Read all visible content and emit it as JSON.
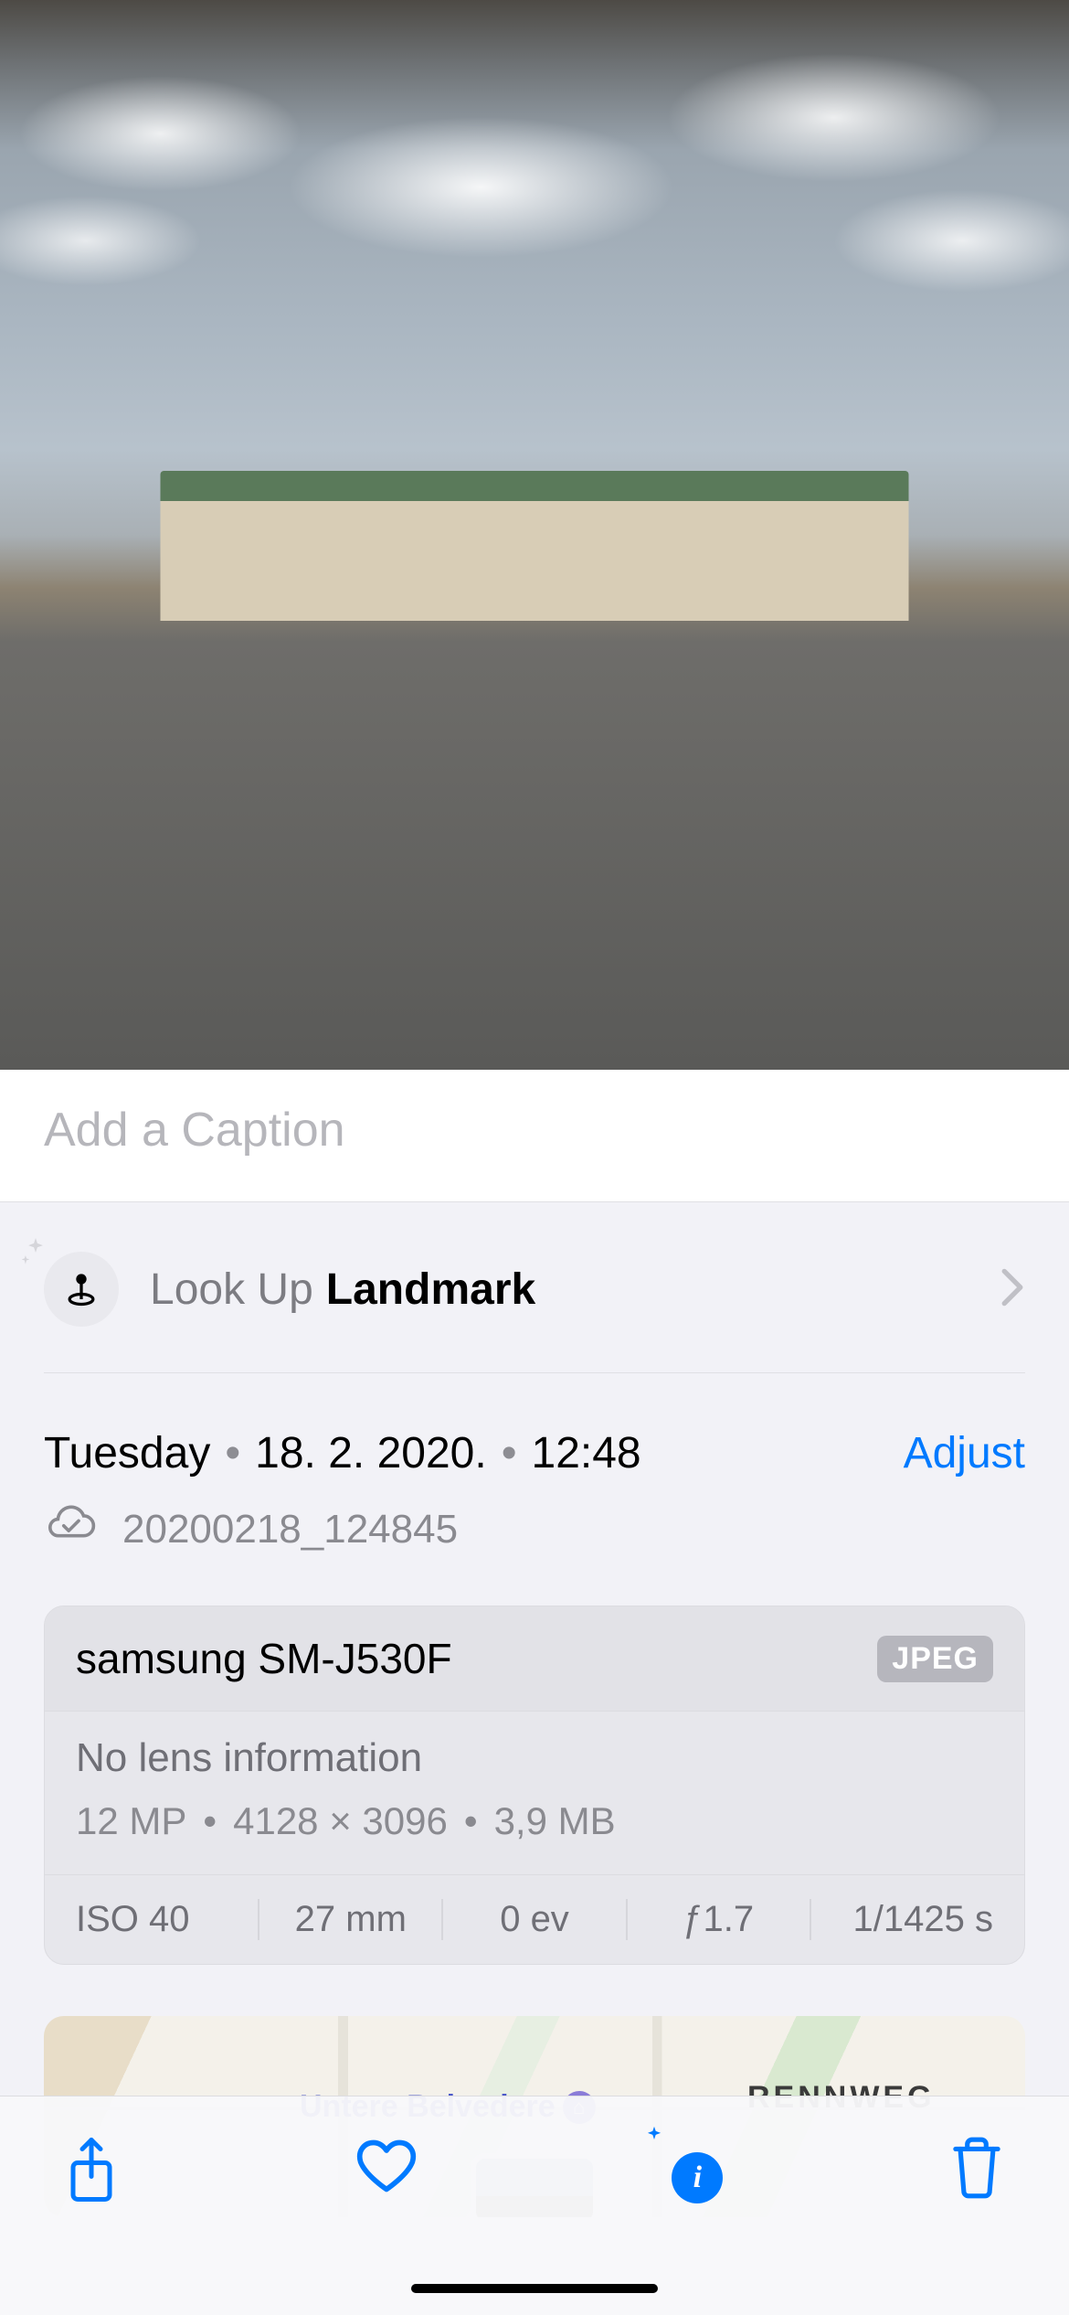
{
  "caption": {
    "placeholder": "Add a Caption"
  },
  "lookup": {
    "prefix": "Look Up",
    "subject": "Landmark"
  },
  "date": {
    "weekday": "Tuesday",
    "date": "18. 2. 2020.",
    "time": "12:48"
  },
  "adjust_label": "Adjust",
  "file": {
    "name": "20200218_124845"
  },
  "exif": {
    "device": "samsung SM-J530F",
    "format_badge": "JPEG",
    "lens": "No lens information",
    "megapixels": "12 MP",
    "dimensions": "4128 × 3096",
    "filesize": "3,9 MB",
    "iso": "ISO 40",
    "focal": "27 mm",
    "ev": "0 ev",
    "aperture": "ƒ1.7",
    "shutter": "1/1425 s"
  },
  "map": {
    "label_belvedere": "Untere Belvedere",
    "label_rennweg": "RENNWEG"
  },
  "separator_dot": "•"
}
